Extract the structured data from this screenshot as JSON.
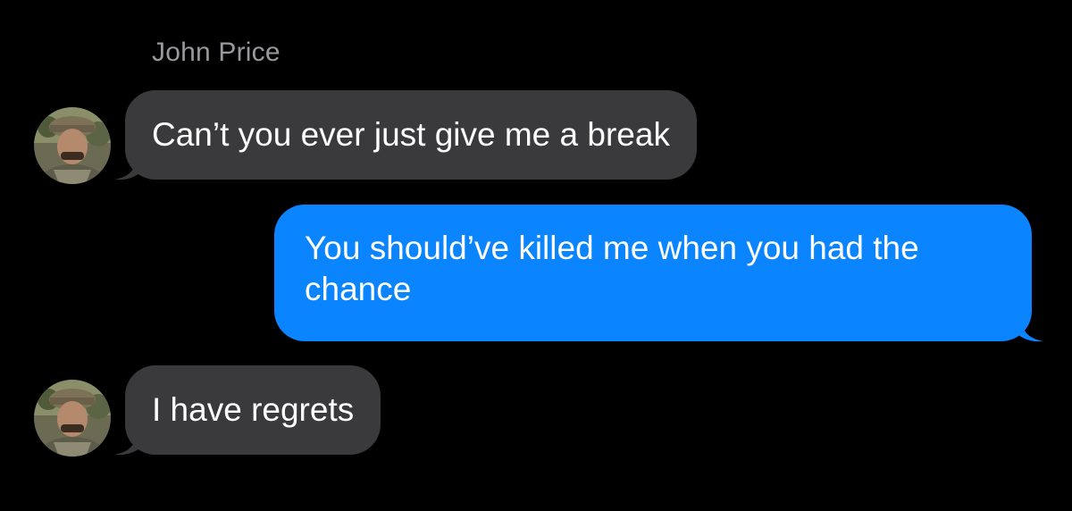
{
  "conversation": {
    "contact_name": "John Price",
    "messages": [
      {
        "direction": "incoming",
        "text": "Can’t you ever just give me a break"
      },
      {
        "direction": "outgoing",
        "text": "You should’ve killed me when you had the chance"
      },
      {
        "direction": "incoming",
        "text": "I have regrets"
      }
    ]
  },
  "colors": {
    "background": "#000000",
    "incoming_bubble": "#3a3a3c",
    "outgoing_bubble": "#0a84ff",
    "sender_name": "#98989d",
    "message_text": "#ffffff"
  },
  "icons": {
    "avatar": "contact-avatar-photo"
  }
}
